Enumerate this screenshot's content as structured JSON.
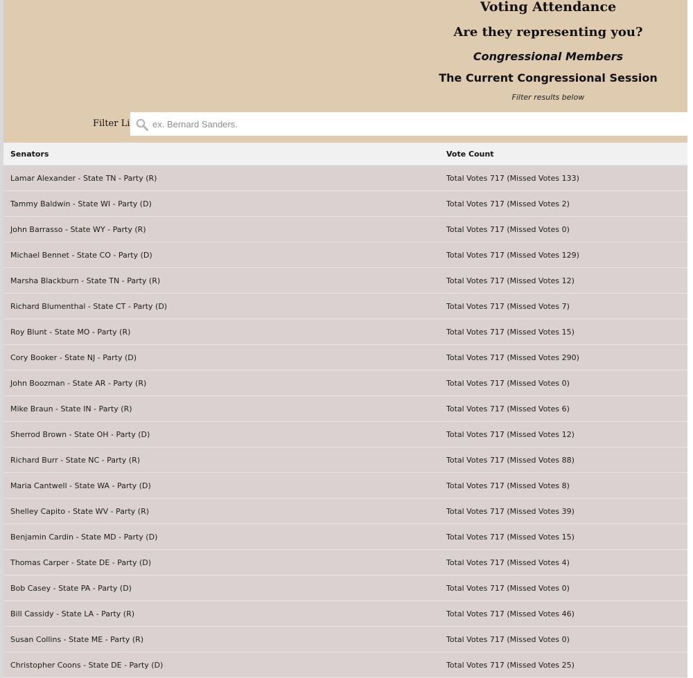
{
  "header": {
    "title": "Voting Attendance",
    "subtitle": "Are they representing you?",
    "members_label": "Congressional Members",
    "session_label": "The Current Congressional Session",
    "filter_hint": "Filter results below"
  },
  "filter": {
    "label": "Filter List",
    "placeholder": "ex. Bernard Sanders.",
    "value": ""
  },
  "table": {
    "columns": [
      "Senators",
      "Vote Count"
    ],
    "rows": [
      {
        "senator": "Lamar Alexander - State TN - Party (R)",
        "votes": "Total Votes 717 (Missed Votes 133)"
      },
      {
        "senator": "Tammy Baldwin - State WI - Party (D)",
        "votes": "Total Votes 717 (Missed Votes 2)"
      },
      {
        "senator": "John Barrasso - State WY - Party (R)",
        "votes": "Total Votes 717 (Missed Votes 0)"
      },
      {
        "senator": "Michael Bennet - State CO - Party (D)",
        "votes": "Total Votes 717 (Missed Votes 129)"
      },
      {
        "senator": "Marsha Blackburn - State TN - Party (R)",
        "votes": "Total Votes 717 (Missed Votes 12)"
      },
      {
        "senator": "Richard Blumenthal - State CT - Party (D)",
        "votes": "Total Votes 717 (Missed Votes 7)"
      },
      {
        "senator": "Roy Blunt - State MO - Party (R)",
        "votes": "Total Votes 717 (Missed Votes 15)"
      },
      {
        "senator": "Cory Booker - State NJ - Party (D)",
        "votes": "Total Votes 717 (Missed Votes 290)"
      },
      {
        "senator": "John Boozman - State AR - Party (R)",
        "votes": "Total Votes 717 (Missed Votes 0)"
      },
      {
        "senator": "Mike Braun - State IN - Party (R)",
        "votes": "Total Votes 717 (Missed Votes 6)"
      },
      {
        "senator": "Sherrod Brown - State OH - Party (D)",
        "votes": "Total Votes 717 (Missed Votes 12)"
      },
      {
        "senator": "Richard Burr - State NC - Party (R)",
        "votes": "Total Votes 717 (Missed Votes 88)"
      },
      {
        "senator": "Maria Cantwell - State WA - Party (D)",
        "votes": "Total Votes 717 (Missed Votes 8)"
      },
      {
        "senator": "Shelley Capito - State WV - Party (R)",
        "votes": "Total Votes 717 (Missed Votes 39)"
      },
      {
        "senator": "Benjamin Cardin - State MD - Party (D)",
        "votes": "Total Votes 717 (Missed Votes 15)"
      },
      {
        "senator": "Thomas Carper - State DE - Party (D)",
        "votes": "Total Votes 717 (Missed Votes 4)"
      },
      {
        "senator": "Bob Casey - State PA - Party (D)",
        "votes": "Total Votes 717 (Missed Votes 0)"
      },
      {
        "senator": "Bill Cassidy - State LA - Party (R)",
        "votes": "Total Votes 717 (Missed Votes 46)"
      },
      {
        "senator": "Susan Collins - State ME - Party (R)",
        "votes": "Total Votes 717 (Missed Votes 0)"
      },
      {
        "senator": "Christopher Coons - State DE - Party (D)",
        "votes": "Total Votes 717 (Missed Votes 25)"
      }
    ]
  },
  "colors": {
    "header_bg": "#dfcbb0",
    "row_bg": "#dcd1d1",
    "table_head_bg": "#f1f1f1"
  },
  "icons": {
    "filter_icon": "search-icon"
  }
}
